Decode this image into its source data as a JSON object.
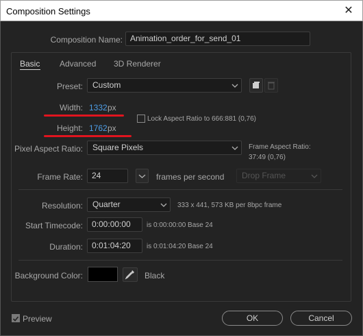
{
  "window": {
    "title": "Composition Settings"
  },
  "composition": {
    "name_label": "Composition Name:",
    "name_value": "Animation_order_for_send_01"
  },
  "tabs": [
    {
      "label": "Basic",
      "active": true
    },
    {
      "label": "Advanced",
      "active": false
    },
    {
      "label": "3D Renderer",
      "active": false
    }
  ],
  "basic": {
    "preset_label": "Preset:",
    "preset_value": "Custom",
    "width_label": "Width:",
    "width_value": "1332",
    "width_unit": "px",
    "height_label": "Height:",
    "height_value": "1762",
    "height_unit": "px",
    "lock_aspect_label": "Lock Aspect Ratio to 666:881 (0,76)",
    "lock_aspect_checked": false,
    "par_label": "Pixel Aspect Ratio:",
    "par_value": "Square Pixels",
    "frame_aspect_label": "Frame Aspect Ratio:",
    "frame_aspect_value": "37:49 (0,76)",
    "frame_rate_label": "Frame Rate:",
    "frame_rate_value": "24",
    "frame_rate_unit": "frames per second",
    "drop_frame_value": "Drop Frame",
    "resolution_label": "Resolution:",
    "resolution_value": "Quarter",
    "resolution_info": "333 x 441, 573 KB per 8bpc frame",
    "start_tc_label": "Start Timecode:",
    "start_tc_value": "0:00:00:00",
    "start_tc_info": "is 0:00:00:00  Base 24",
    "duration_label": "Duration:",
    "duration_value": "0:01:04:20",
    "duration_info": "is 0:01:04:20  Base 24",
    "bg_color_label": "Background Color:",
    "bg_color_name": "Black",
    "bg_color_hex": "#000000"
  },
  "footer": {
    "preview_label": "Preview",
    "preview_checked": true,
    "ok_label": "OK",
    "cancel_label": "Cancel"
  },
  "colors": {
    "accent_blue": "#4d9ee8",
    "annotation_red": "#e0141e",
    "panel_bg": "#232323"
  }
}
